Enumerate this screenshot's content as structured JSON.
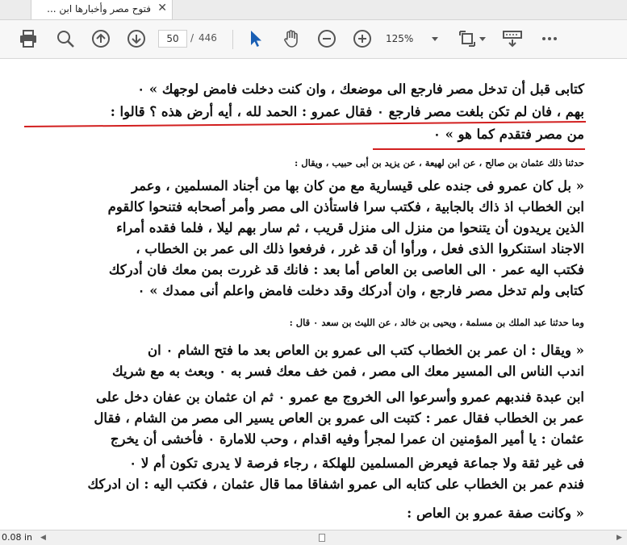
{
  "tab": {
    "title": "فتوح مصر وأخبارها ابن ...",
    "close_glyph": "✕"
  },
  "toolbar": {
    "page_current": "50",
    "page_separator": "/",
    "page_total": "446",
    "zoom": "125%"
  },
  "document": {
    "lines": [
      "كتابى قبل أن تدخل مصر فارجع الى موضعك ، وان كنت دخلت فامض لوجهك » ٠",
      "بهم ، فان لم تكن بلغت مصر فارجع ٠ فقال عمرو : الحمد لله ، أيه أرض هذه ؟ قالوا :",
      "من مصر فتقدم كما هو » ٠",
      "حدثنا ذلك عثمان بن صالح ، عن ابن لهيعة ، عن يزيد بن أبى حبيب ، ويقال :",
      "« بل كان عمرو فى جنده على قيسارية مع من كان بها من أجناد المسلمين ، وعمر",
      "ابن الخطاب اذ ذاك بالجابية ، فكتب سرا فاستأذن الى مصر وأمر أصحابه فتنحوا كالقوم",
      "الذين يريدون أن يتنحوا من منزل الى منزل قريب ، ثم سار بهم ليلا ، فلما فقده أمراء",
      "الاجناد استنكروا الذى فعل ، ورأوا أن قد غرر ، فرفعوا ذلك الى عمر بن الخطاب ،",
      "فكتب اليه عمر ٠ الى العاصى بن العاص أما بعد : فانك قد غررت بمن معك فان أدركك",
      "كتابى ولم تدخل مصر فارجع ، وان أدركك وقد دخلت فامض واعلم أنى ممدك » ٠",
      "وما حدثنا عبد الملك بن مسلمة ، ويحيى بن خالد ، عن الليث بن سعد ٠ قال :",
      "« ويقال : ان عمر بن الخطاب كتب الى عمرو بن العاص بعد ما فتح الشام ٠ ان",
      "اندب الناس الى المسير معك الى مصر ، فمن خف معك فسر به ٠ وبعث به مع شريك",
      "ابن عبدة فندبهم عمرو وأسرعوا الى الخروج مع عمرو ٠ ثم ان عثمان بن عفان دخل على",
      "عمر بن الخطاب فقال عمر : كتبت الى عمرو بن العاص يسير الى مصر من الشام ، فقال",
      "عثمان : يا أمير المؤمنين ان عمرا لمجرأ وفيه اقدام ، وحب للامارة ٠ فأخشى أن يخرج",
      "فى غير ثقة ولا جماعة فيعرض المسلمين للهلكة ، رجاء فرصة لا يدرى تكون أم لا ٠",
      "فندم عمر بن الخطاب على كتابه الى عمرو اشفاقا مما قال عثمان ، فكتب اليه : ان ادركك",
      "« وكانت صفة عمرو بن العاص :"
    ]
  },
  "statusbar": {
    "size_text": "0.08 in"
  },
  "colors": {
    "underline": "#d21f1f",
    "toolbar_bg": "#f7f7f7",
    "tab_active_bg": "#ffffff"
  }
}
